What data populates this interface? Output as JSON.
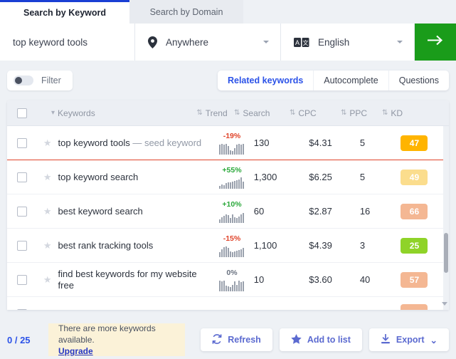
{
  "tabs": [
    {
      "label": "Search by Keyword",
      "active": true
    },
    {
      "label": "Search by Domain",
      "active": false
    }
  ],
  "search": {
    "keyword_value": "top keyword tools",
    "location_value": "Anywhere",
    "location_icon": "location-pin-icon",
    "language_value": "English",
    "language_icon": "translate-icon",
    "submit_icon": "arrow-right-icon",
    "submit_color": "#1a9c1a"
  },
  "controls": {
    "filter_label": "Filter",
    "filter_on": false,
    "views": [
      {
        "label": "Related keywords",
        "active": true
      },
      {
        "label": "Autocomplete",
        "active": false
      },
      {
        "label": "Questions",
        "active": false
      }
    ]
  },
  "table": {
    "headers": {
      "keywords": "Keywords",
      "trend": "Trend",
      "search": "Search",
      "cpc": "CPC",
      "ppc": "PPC",
      "kd": "KD"
    },
    "sort_icon_keywords": "▾",
    "sort_icon": "⇅",
    "rows": [
      {
        "keyword": "top keyword tools",
        "seed_tag": "— seed keyword",
        "is_seed": true,
        "trend_pct": "-19%",
        "trend_dir": "down",
        "spark": [
          14,
          15,
          14,
          15,
          12,
          6,
          5,
          9,
          14,
          15,
          14,
          15
        ],
        "search": "130",
        "cpc": "$4.31",
        "ppc": "5",
        "kd": "47",
        "kd_color": "#ffb400"
      },
      {
        "keyword": "top keyword search",
        "seed_tag": "",
        "is_seed": false,
        "trend_pct": "+55%",
        "trend_dir": "up",
        "spark": [
          4,
          6,
          5,
          8,
          9,
          9,
          10,
          11,
          12,
          13,
          16,
          10
        ],
        "search": "1,300",
        "cpc": "$6.25",
        "ppc": "5",
        "kd": "49",
        "kd_color": "#fbdd8d"
      },
      {
        "keyword": "best keyword search",
        "seed_tag": "",
        "is_seed": false,
        "trend_pct": "+10%",
        "trend_dir": "up",
        "spark": [
          5,
          8,
          10,
          12,
          11,
          7,
          12,
          8,
          7,
          9,
          12,
          14
        ],
        "search": "60",
        "cpc": "$2.87",
        "ppc": "16",
        "kd": "66",
        "kd_color": "#f4b793"
      },
      {
        "keyword": "best rank tracking tools",
        "seed_tag": "",
        "is_seed": false,
        "trend_pct": "-15%",
        "trend_dir": "down",
        "spark": [
          7,
          11,
          14,
          15,
          13,
          8,
          7,
          8,
          9,
          10,
          11,
          13
        ],
        "search": "1,100",
        "cpc": "$4.39",
        "ppc": "3",
        "kd": "25",
        "kd_color": "#8fd328"
      },
      {
        "keyword": "find best keywords for my website free",
        "seed_tag": "",
        "is_seed": false,
        "trend_pct": "0%",
        "trend_dir": "flat",
        "spark": [
          15,
          14,
          15,
          8,
          7,
          6,
          9,
          14,
          9,
          15,
          13,
          14
        ],
        "search": "10",
        "cpc": "$3.60",
        "ppc": "40",
        "kd": "57",
        "kd_color": "#f4b793"
      }
    ],
    "partial_row": {
      "kd_color": "#f4b793"
    }
  },
  "footer": {
    "counter": "0 / 25",
    "notice_text": "There are more keywords available.",
    "notice_link": "Upgrade",
    "buttons": [
      {
        "label": "Refresh",
        "icon": "refresh-icon"
      },
      {
        "label": "Add to list",
        "icon": "star-icon"
      },
      {
        "label": "Export",
        "icon": "download-icon",
        "caret": "⌄"
      }
    ]
  }
}
